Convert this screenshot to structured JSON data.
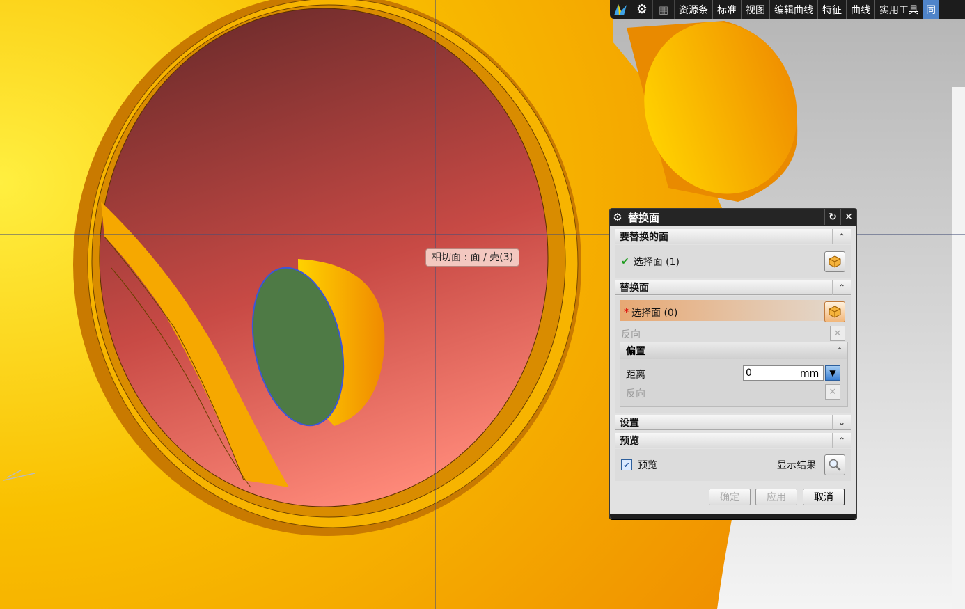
{
  "toolbar": {
    "icons": [
      "nx-logo-icon",
      "gear-icon",
      "grid-icon"
    ],
    "tabs": [
      "资源条",
      "标准",
      "视图",
      "编辑曲线",
      "特征",
      "曲线",
      "实用工具",
      "同"
    ]
  },
  "tooltip": {
    "text": "相切面 : 面 / 壳(3)"
  },
  "dialog": {
    "title": "替换面",
    "sections": {
      "face_to_replace": {
        "header": "要替换的面",
        "select_label": "选择面 (1)"
      },
      "replacement_face": {
        "header": "替换面",
        "select_label": "选择面 (0)",
        "reverse_label": "反向"
      },
      "offset": {
        "header": "偏置",
        "distance_label": "距离",
        "distance_value": "0",
        "unit": "mm",
        "reverse_label": "反向"
      },
      "settings": {
        "header": "设置"
      },
      "preview": {
        "header": "预览",
        "checkbox_label": "预览",
        "checked": true,
        "show_result_label": "显示结果"
      }
    },
    "buttons": {
      "ok": "确定",
      "apply": "应用",
      "cancel": "取消"
    }
  },
  "colors": {
    "model_orange": "#f5a800",
    "inner_red": "#c54a45",
    "selected_green": "#4e7a45",
    "highlight_blue": "#3c56d8",
    "toolbar_bg": "#1c1c1c",
    "dialog_bg": "#e2e2e2",
    "required_highlight": "#e7a873"
  }
}
